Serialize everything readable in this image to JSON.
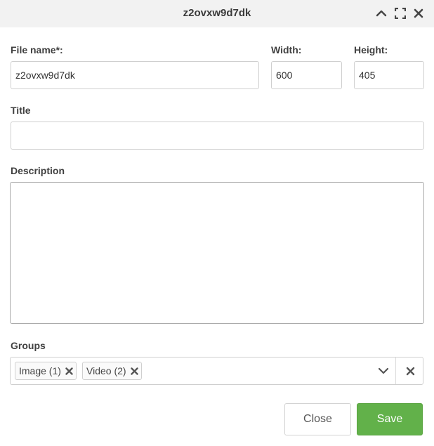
{
  "dialog": {
    "title": "z2ovxw9d7dk"
  },
  "form": {
    "file_name": {
      "label": "File name*:",
      "value": "z2ovxw9d7dk"
    },
    "width": {
      "label": "Width:",
      "value": "600"
    },
    "height": {
      "label": "Height:",
      "value": "405"
    },
    "title_field": {
      "label": "Title",
      "value": ""
    },
    "description": {
      "label": "Description",
      "value": ""
    },
    "groups": {
      "label": "Groups",
      "tags": [
        {
          "label": "Image (1)"
        },
        {
          "label": "Video (2)"
        }
      ]
    }
  },
  "buttons": {
    "close_label": "Close",
    "save_label": "Save"
  },
  "icons": {
    "collapse": "chevron-up-icon",
    "maximize": "expand-icon",
    "close": "close-icon",
    "tag_remove": "remove-tag-icon",
    "dropdown": "chevron-down-icon",
    "clear": "clear-icon"
  },
  "colors": {
    "titlebar_bg": "#f2f2f2",
    "save_button": "#62b14a",
    "text": "#333333"
  }
}
